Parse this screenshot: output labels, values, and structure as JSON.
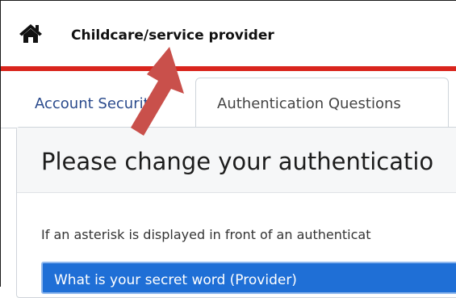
{
  "header": {
    "home_icon": "home-icon",
    "brand_title": "Childcare/service provider",
    "accent_color": "#d9251d"
  },
  "tabs": [
    {
      "label": "Account Security",
      "active": false
    },
    {
      "label": "Authentication Questions",
      "active": true
    }
  ],
  "panel": {
    "title": "Please change your authenticatio",
    "description": "If an asterisk is displayed in front of an authenticat",
    "select_value": "What is your secret word (Provider)"
  },
  "annotation": {
    "icon": "arrow-up-icon",
    "color": "#c9504b"
  }
}
